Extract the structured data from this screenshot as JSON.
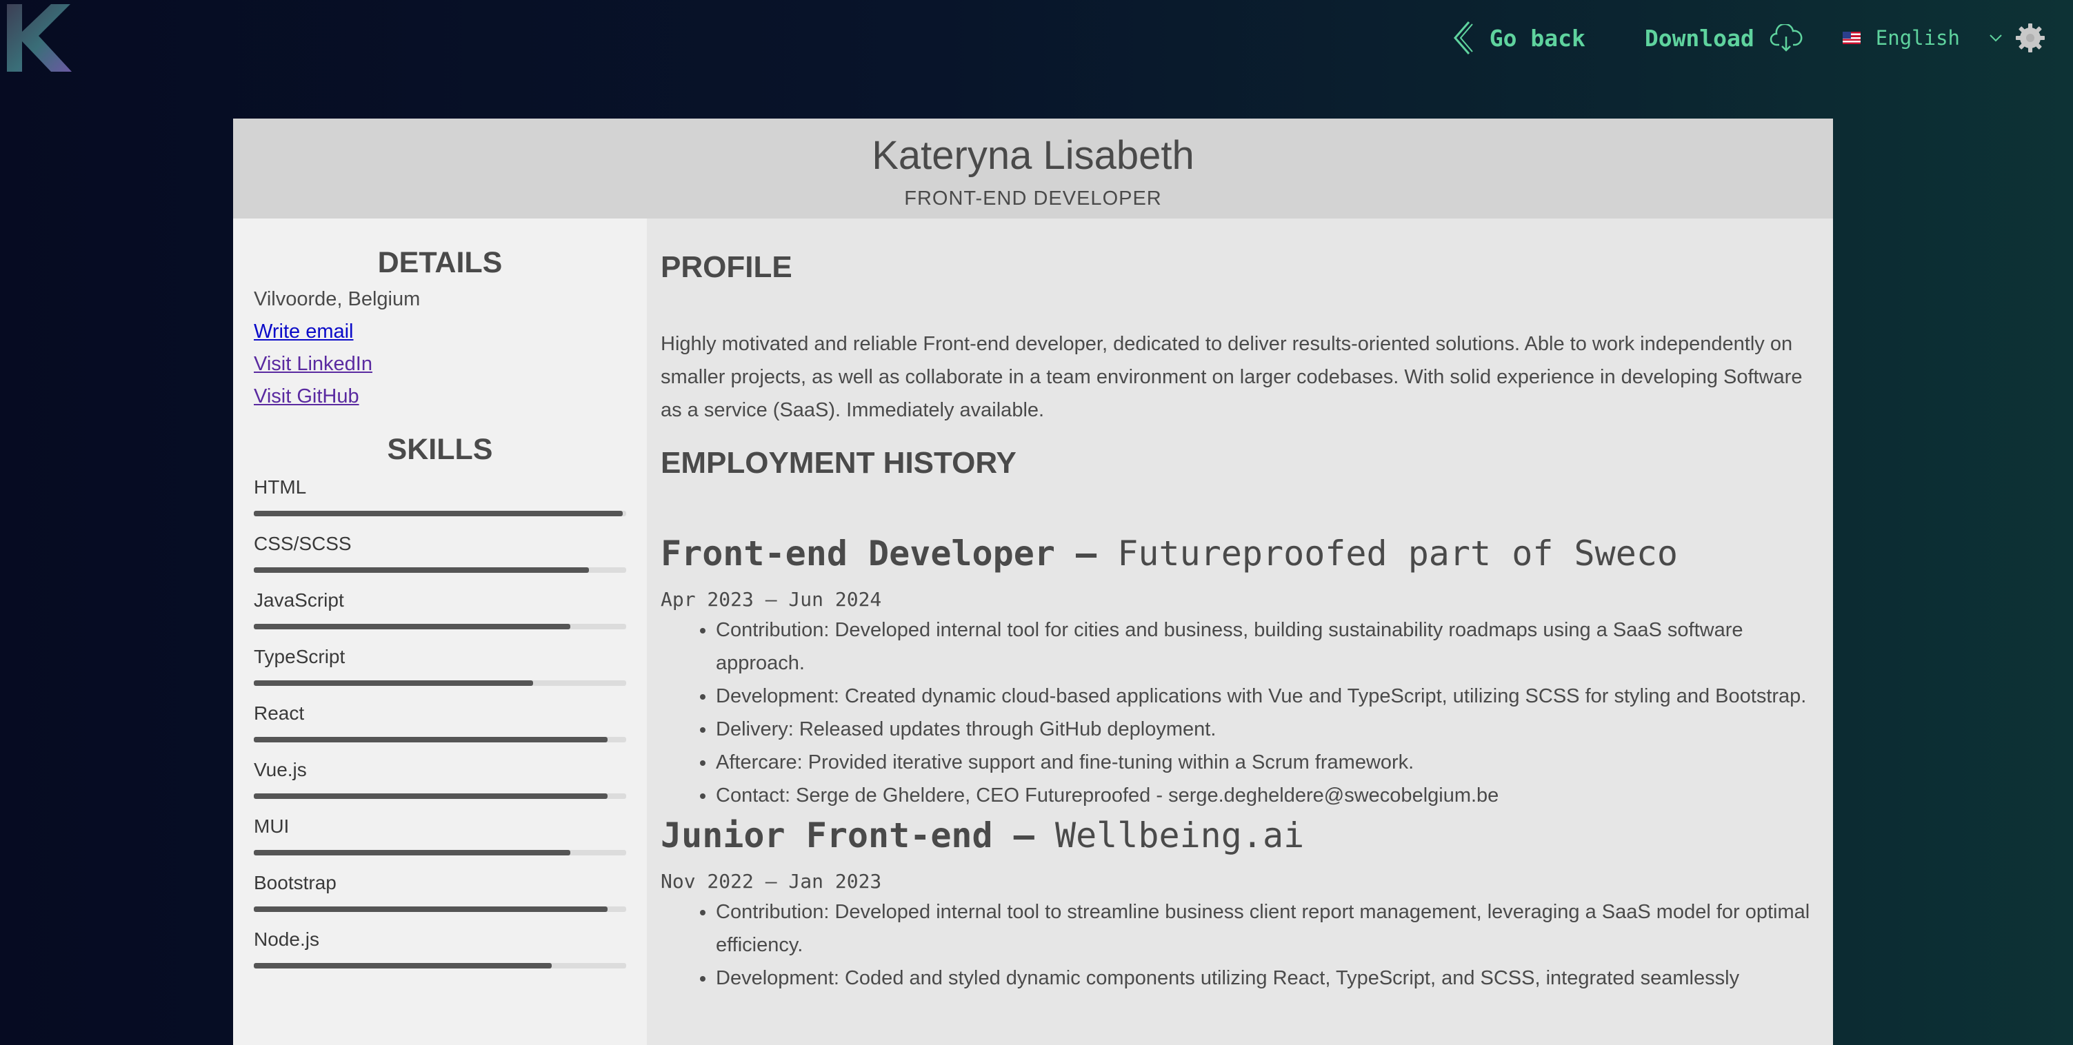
{
  "app": {
    "logo_text": "K",
    "nav": {
      "back_label": "Go back",
      "download_label": "Download",
      "language": "English"
    }
  },
  "resume": {
    "name": "Kateryna Lisabeth",
    "role": "FRONT-END DEVELOPER",
    "details": {
      "heading": "DETAILS",
      "location": "Vilvoorde, Belgium",
      "links": [
        "Write email",
        "Visit LinkedIn",
        "Visit GitHub"
      ]
    },
    "skills": {
      "heading": "SKILLS",
      "items": [
        {
          "name": "HTML",
          "level": 0.99
        },
        {
          "name": "CSS/SCSS",
          "level": 0.9
        },
        {
          "name": "JavaScript",
          "level": 0.85
        },
        {
          "name": "TypeScript",
          "level": 0.75
        },
        {
          "name": "React",
          "level": 0.95
        },
        {
          "name": "Vue.js",
          "level": 0.95
        },
        {
          "name": "MUI",
          "level": 0.85
        },
        {
          "name": "Bootstrap",
          "level": 0.95
        },
        {
          "name": "Node.js",
          "level": 0.8
        }
      ]
    },
    "profile": {
      "heading": "PROFILE",
      "text": "Highly motivated and reliable Front-end developer, dedicated to deliver results-oriented solutions. Able to work independently on smaller projects, as well as collaborate in a team environment on larger codebases. With solid experience in developing Software as a service (SaaS). Immediately available."
    },
    "employment": {
      "heading": "EMPLOYMENT HISTORY",
      "jobs": [
        {
          "title": "Front-end Developer –",
          "company": "Futureproofed part of Sweco",
          "dates": "Apr 2023 – Jun 2024",
          "bullets": [
            "Contribution: Developed internal tool for cities and business, building sustainability roadmaps using a SaaS software approach.",
            "Development: Created dynamic cloud-based applications with Vue and TypeScript, utilizing SCSS for styling and Bootstrap.",
            "Delivery: Released updates through GitHub deployment.",
            "Aftercare: Provided iterative support and fine-tuning within a Scrum framework.",
            "Contact: Serge de Gheldere, CEO Futureproofed - serge.degheldere@swecobelgium.be"
          ]
        },
        {
          "title": "Junior Front-end –",
          "company": "Wellbeing.ai",
          "dates": "Nov 2022 – Jan 2023",
          "bullets": [
            "Contribution: Developed internal tool to streamline business client report management, leveraging a SaaS model for optimal efficiency.",
            "Development: Coded and styled dynamic components utilizing React, TypeScript, and SCSS, integrated seamlessly"
          ]
        }
      ]
    }
  }
}
